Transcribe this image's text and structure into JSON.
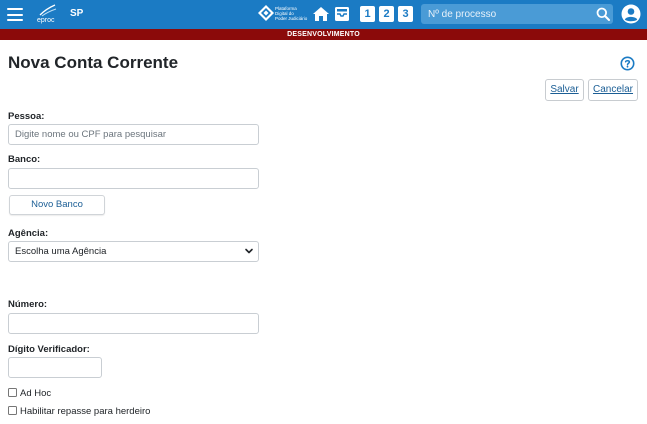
{
  "header": {
    "app_name": "eproc",
    "region": "SP",
    "pdpj_lines": [
      "Plataforma",
      "Digital do",
      "Poder Judiciário"
    ],
    "quick_numbers": [
      "1",
      "2",
      "3"
    ],
    "search_placeholder": "Nº de processo",
    "brand_color": "#1b7bc4"
  },
  "environment_banner": "DESENVOLVIMENTO",
  "page": {
    "title": "Nova Conta Corrente",
    "save_label": "Salvar",
    "cancel_label": "Cancelar"
  },
  "form": {
    "pessoa": {
      "label": "Pessoa:",
      "placeholder": "Digite nome ou CPF para pesquisar",
      "value": ""
    },
    "banco": {
      "label": "Banco:",
      "value": "",
      "new_button": "Novo Banco"
    },
    "agencia": {
      "label": "Agência:",
      "selected": "Escolha uma Agência"
    },
    "numero": {
      "label": "Número:",
      "value": ""
    },
    "digito": {
      "label": "Dígito Verificador:",
      "value": ""
    },
    "ad_hoc": {
      "label": "Ad Hoc",
      "checked": false
    },
    "repasse": {
      "label": "Habilitar repasse para herdeiro",
      "checked": false
    }
  },
  "icons": [
    "menu-icon",
    "home-icon",
    "inbox-icon",
    "search-icon",
    "user-icon",
    "help-icon",
    "chevron-down-icon"
  ]
}
